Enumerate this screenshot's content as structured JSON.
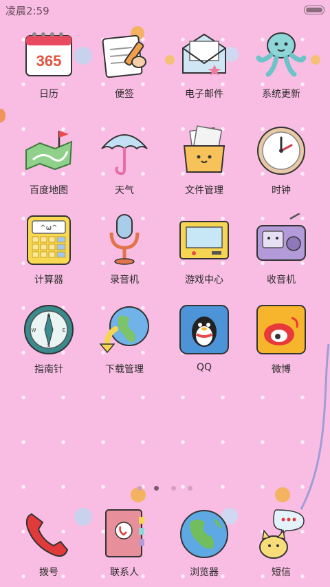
{
  "status_bar": {
    "time": "凌晨2:59"
  },
  "apps": [
    {
      "id": "calendar",
      "label": "日历",
      "icon": "calendar-365-icon",
      "badge": "365"
    },
    {
      "id": "notes",
      "label": "便签",
      "icon": "notepad-icon"
    },
    {
      "id": "email",
      "label": "电子邮件",
      "icon": "envelope-icon"
    },
    {
      "id": "update",
      "label": "系统更新",
      "icon": "octopus-icon"
    },
    {
      "id": "maps",
      "label": "百度地图",
      "icon": "map-flag-icon"
    },
    {
      "id": "weather",
      "label": "天气",
      "icon": "umbrella-icon"
    },
    {
      "id": "files",
      "label": "文件管理",
      "icon": "file-box-icon"
    },
    {
      "id": "clock",
      "label": "时钟",
      "icon": "clock-icon"
    },
    {
      "id": "calculator",
      "label": "计算器",
      "icon": "calculator-icon"
    },
    {
      "id": "recorder",
      "label": "录音机",
      "icon": "microphone-icon"
    },
    {
      "id": "games",
      "label": "游戏中心",
      "icon": "game-screen-icon"
    },
    {
      "id": "radio",
      "label": "收音机",
      "icon": "radio-icon"
    },
    {
      "id": "compass",
      "label": "指南针",
      "icon": "compass-icon",
      "compass_letters": [
        "N",
        "S",
        "E",
        "W"
      ]
    },
    {
      "id": "downloads",
      "label": "下载管理",
      "icon": "globe-download-icon"
    },
    {
      "id": "qq",
      "label": "QQ",
      "icon": "qq-penguin-icon"
    },
    {
      "id": "weibo",
      "label": "微博",
      "icon": "weibo-icon"
    }
  ],
  "page_indicator": {
    "pages": 4,
    "active": 2
  },
  "dock": [
    {
      "id": "dialer",
      "label": "拨号",
      "icon": "phone-handset-icon"
    },
    {
      "id": "contacts",
      "label": "联系人",
      "icon": "contacts-book-icon"
    },
    {
      "id": "browser",
      "label": "浏览器",
      "icon": "globe-icon"
    },
    {
      "id": "sms",
      "label": "短信",
      "icon": "chat-bubble-cat-icon"
    }
  ],
  "colors": {
    "background": "#f9bde3",
    "label_text": "#2b2b2b"
  }
}
